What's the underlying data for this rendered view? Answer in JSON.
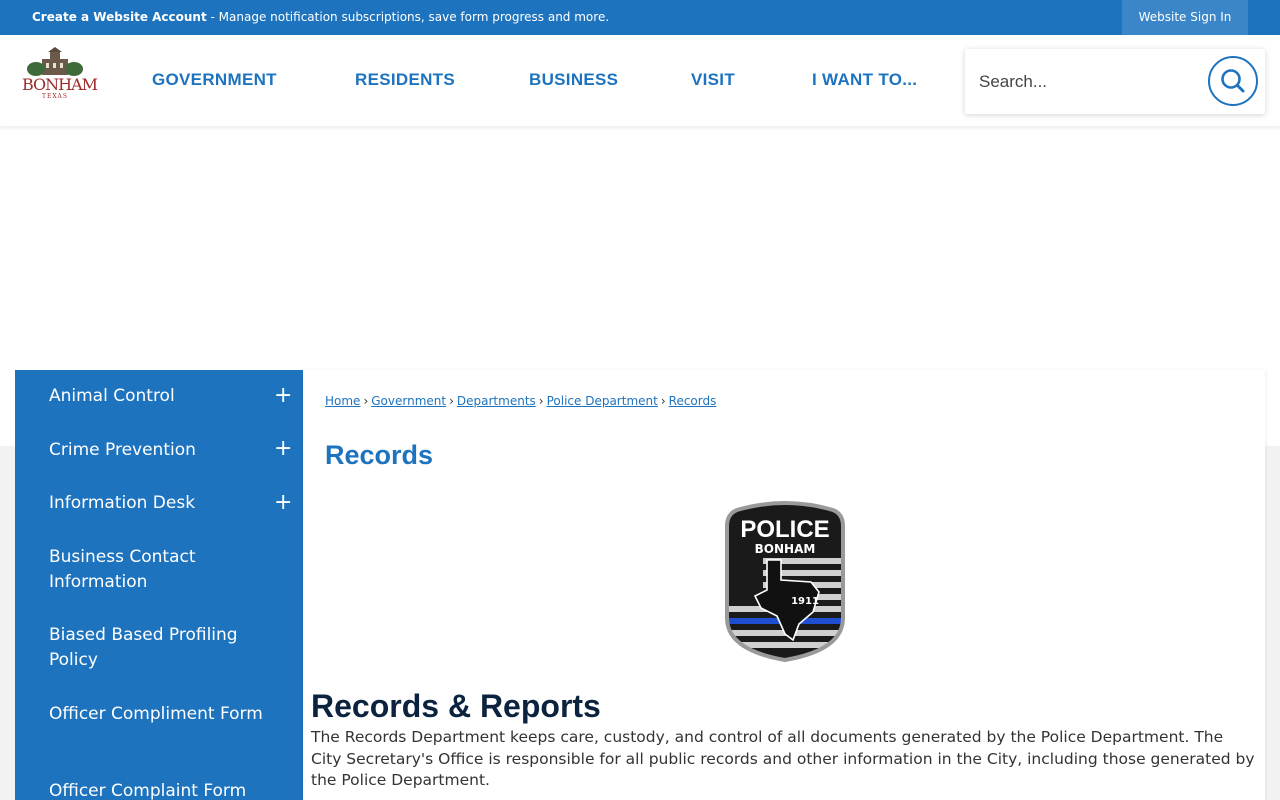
{
  "topbar": {
    "account_link": "Create a Website Account",
    "account_desc": " - Manage notification subscriptions, save form progress and more.",
    "signin": "Website Sign In"
  },
  "logo": {
    "text": "BONHAM",
    "sub": "TEXAS"
  },
  "nav": {
    "items": [
      "GOVERNMENT",
      "RESIDENTS",
      "BUSINESS",
      "VISIT",
      "I WANT TO..."
    ]
  },
  "search": {
    "placeholder": "Search...",
    "icon": "search-icon"
  },
  "sidebar": {
    "items": [
      {
        "label": "Animal Control",
        "expandable": true
      },
      {
        "label": "Crime Prevention",
        "expandable": true
      },
      {
        "label": "Information Desk",
        "expandable": true
      },
      {
        "label": "Business Contact Information",
        "expandable": false
      },
      {
        "label": "Biased Based Profiling Policy",
        "expandable": false
      },
      {
        "label": "Officer Compliment Form",
        "expandable": false
      },
      {
        "label": "Officer Complaint Form",
        "expandable": false
      }
    ],
    "plus_symbol": "+"
  },
  "breadcrumb": [
    "Home",
    "Government",
    "Departments",
    "Police Department",
    "Records"
  ],
  "breadcrumb_sep": "›",
  "page": {
    "title": "Records",
    "section_title": "Records & Reports",
    "body": "The Records Department keeps care, custody, and control of all documents generated by the Police Department. The City Secretary's Office is responsible for all public records and other information in the City, including those generated by the Police Department."
  },
  "badge": {
    "line1": "POLICE",
    "line2": "BONHAM",
    "year": "1911"
  },
  "colors": {
    "primary": "#1e73be",
    "heading": "#0c2340",
    "logo": "#9c2a2a"
  }
}
